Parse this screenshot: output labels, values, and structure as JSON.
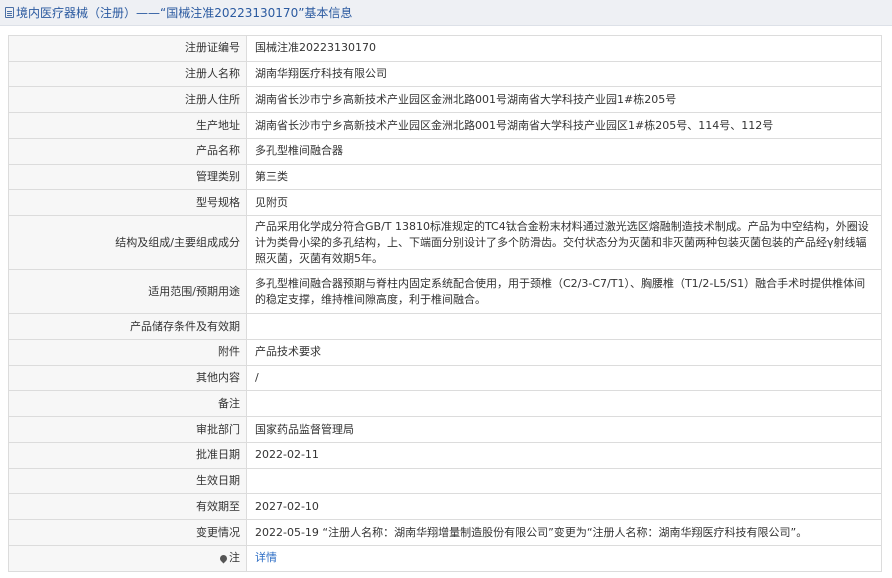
{
  "header": {
    "title": "境内医疗器械（注册）——“国械注准20223130170”基本信息",
    "icon": "document-icon"
  },
  "rows": [
    {
      "label": "注册证编号",
      "value": "国械注准20223130170"
    },
    {
      "label": "注册人名称",
      "value": "湖南华翔医疗科技有限公司"
    },
    {
      "label": "注册人住所",
      "value": "湖南省长沙市宁乡高新技术产业园区金洲北路001号湖南省大学科技产业园1#栋205号"
    },
    {
      "label": "生产地址",
      "value": "湖南省长沙市宁乡高新技术产业园区金洲北路001号湖南省大学科技产业园区1#栋205号、114号、112号"
    },
    {
      "label": "产品名称",
      "value": "多孔型椎间融合器"
    },
    {
      "label": "管理类别",
      "value": "第三类"
    },
    {
      "label": "型号规格",
      "value": "见附页"
    },
    {
      "label": "结构及组成/主要组成成分",
      "value": "产品采用化学成分符合GB/T 13810标准规定的TC4钛合金粉末材料通过激光选区熔融制造技术制成。产品为中空结构，外圈设计为类骨小梁的多孔结构，上、下端面分别设计了多个防滑齿。交付状态分为灭菌和非灭菌两种包装灭菌包装的产品经γ射线辐照灭菌，灭菌有效期5年。"
    },
    {
      "label": "适用范围/预期用途",
      "value": "多孔型椎间融合器预期与脊柱内固定系统配合使用，用于颈椎（C2/3-C7/T1）、胸腰椎（T1/2-L5/S1）融合手术时提供椎体间的稳定支撑，维持椎间隙高度，利于椎间融合。"
    },
    {
      "label": "产品储存条件及有效期",
      "value": ""
    },
    {
      "label": "附件",
      "value": "产品技术要求"
    },
    {
      "label": "其他内容",
      "value": "/"
    },
    {
      "label": "备注",
      "value": ""
    },
    {
      "label": "审批部门",
      "value": "国家药品监督管理局"
    },
    {
      "label": "批准日期",
      "value": "2022-02-11"
    },
    {
      "label": "生效日期",
      "value": ""
    },
    {
      "label": "有效期至",
      "value": "2027-02-10"
    },
    {
      "label": "变更情况",
      "value": "2022-05-19 “注册人名称：湖南华翔增量制造股份有限公司”变更为“注册人名称：湖南华翔医疗科技有限公司”。"
    },
    {
      "label": "注",
      "value": "详情",
      "icon": "pin-icon"
    }
  ]
}
